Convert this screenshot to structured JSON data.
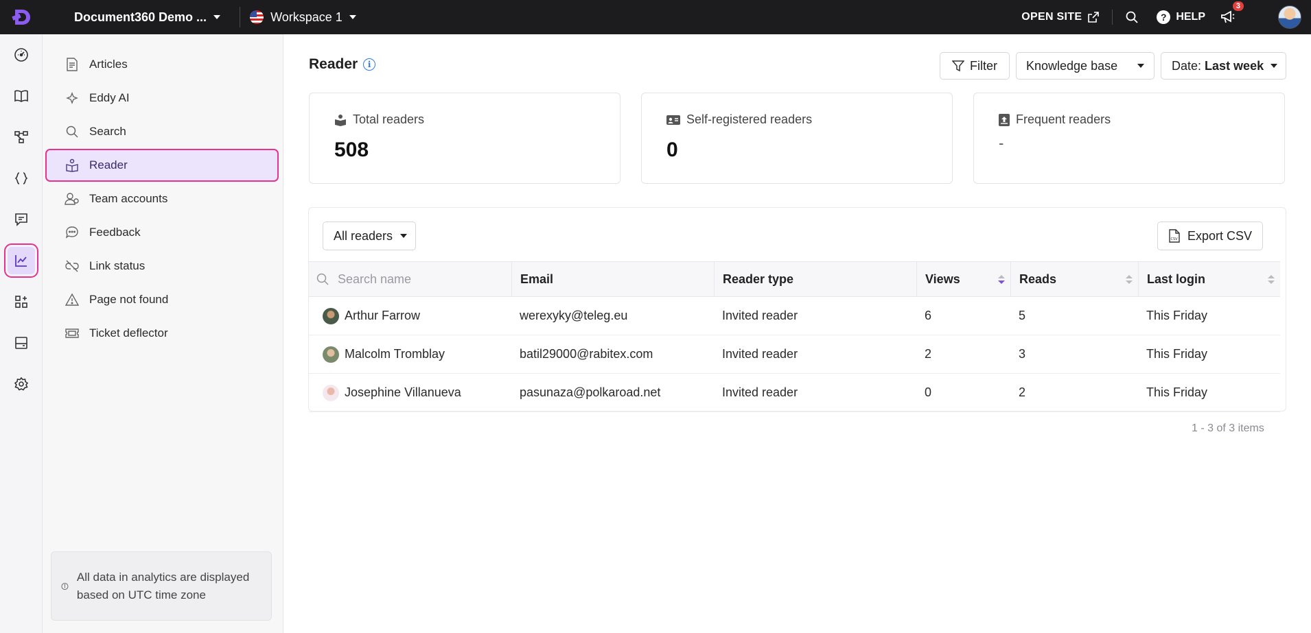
{
  "topbar": {
    "project_name": "Document360 Demo ...",
    "workspace": "Workspace 1",
    "open_site": "OPEN SITE",
    "help": "HELP",
    "notifications_count": "3"
  },
  "rail": {
    "items": [
      {
        "icon": "dashboard-icon"
      },
      {
        "icon": "documentation-icon"
      },
      {
        "icon": "workflow-icon"
      },
      {
        "icon": "api-icon"
      },
      {
        "icon": "feedback-icon"
      },
      {
        "icon": "analytics-icon",
        "active": true
      },
      {
        "icon": "apps-icon"
      },
      {
        "icon": "widget-icon"
      },
      {
        "icon": "settings-icon"
      }
    ]
  },
  "subnav": {
    "items": [
      {
        "label": "Articles",
        "icon": "article-icon"
      },
      {
        "label": "Eddy AI",
        "icon": "sparkle-icon"
      },
      {
        "label": "Search",
        "icon": "search-icon"
      },
      {
        "label": "Reader",
        "icon": "reader-icon",
        "active": true
      },
      {
        "label": "Team accounts",
        "icon": "team-icon"
      },
      {
        "label": "Feedback",
        "icon": "chat-icon"
      },
      {
        "label": "Link status",
        "icon": "broken-link-icon"
      },
      {
        "label": "Page not found",
        "icon": "warning-icon"
      },
      {
        "label": "Ticket deflector",
        "icon": "ticket-icon"
      }
    ],
    "note": "All data in analytics are displayed based on UTC time zone"
  },
  "main": {
    "title": "Reader",
    "filter_label": "Filter",
    "kb_label": "Knowledge base",
    "date_prefix": "Date:",
    "date_value": "Last week",
    "cards": [
      {
        "label": "Total readers",
        "value": "508",
        "icon": "reader-badge-icon"
      },
      {
        "label": "Self-registered readers",
        "value": "0",
        "icon": "id-card-icon"
      },
      {
        "label": "Frequent readers",
        "value": "-",
        "icon": "frequent-icon"
      }
    ],
    "readers_filter": "All readers",
    "export_label": "Export CSV",
    "table": {
      "search_placeholder": "Search name",
      "headers": [
        "Email",
        "Reader type",
        "Views",
        "Reads",
        "Last login"
      ],
      "rows": [
        {
          "name": "Arthur Farrow",
          "email": "werexyky@teleg.eu",
          "type": "Invited reader",
          "views": "6",
          "reads": "5",
          "last_login": "This Friday"
        },
        {
          "name": "Malcolm Tromblay",
          "email": "batil29000@rabitex.com",
          "type": "Invited reader",
          "views": "2",
          "reads": "3",
          "last_login": "This Friday"
        },
        {
          "name": "Josephine Villanueva",
          "email": "pasunaza@polkaroad.net",
          "type": "Invited reader",
          "views": "0",
          "reads": "2",
          "last_login": "This Friday"
        }
      ]
    },
    "pagination": "1 - 3 of 3 items"
  },
  "colors": {
    "accent": "#7b4fe0",
    "highlight": "#e8338e",
    "topbar": "#1c1c1e"
  }
}
